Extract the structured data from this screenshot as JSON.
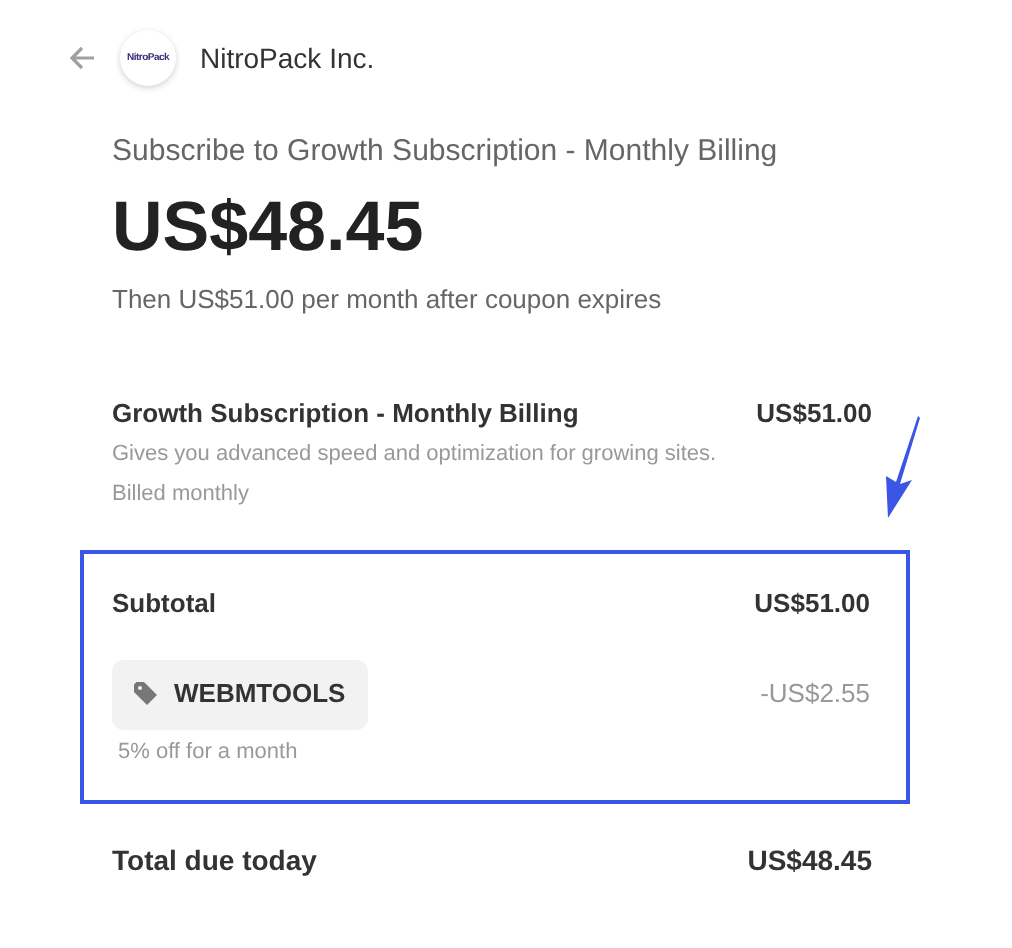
{
  "header": {
    "logo_text": "NitroPack",
    "company": "NitroPack Inc."
  },
  "summary": {
    "title": "Subscribe to Growth Subscription - Monthly Billing",
    "price": "US$48.45",
    "note": "Then US$51.00 per month after coupon expires"
  },
  "line_item": {
    "name": "Growth Subscription - Monthly Billing",
    "amount": "US$51.00",
    "description": "Gives you advanced speed and optimization for growing sites.",
    "billing": "Billed monthly"
  },
  "subtotal": {
    "label": "Subtotal",
    "amount": "US$51.00"
  },
  "coupon": {
    "code": "WEBMTOOLS",
    "amount": "-US$2.55",
    "terms": "5% off for a month"
  },
  "total": {
    "label": "Total due today",
    "amount": "US$48.45"
  }
}
